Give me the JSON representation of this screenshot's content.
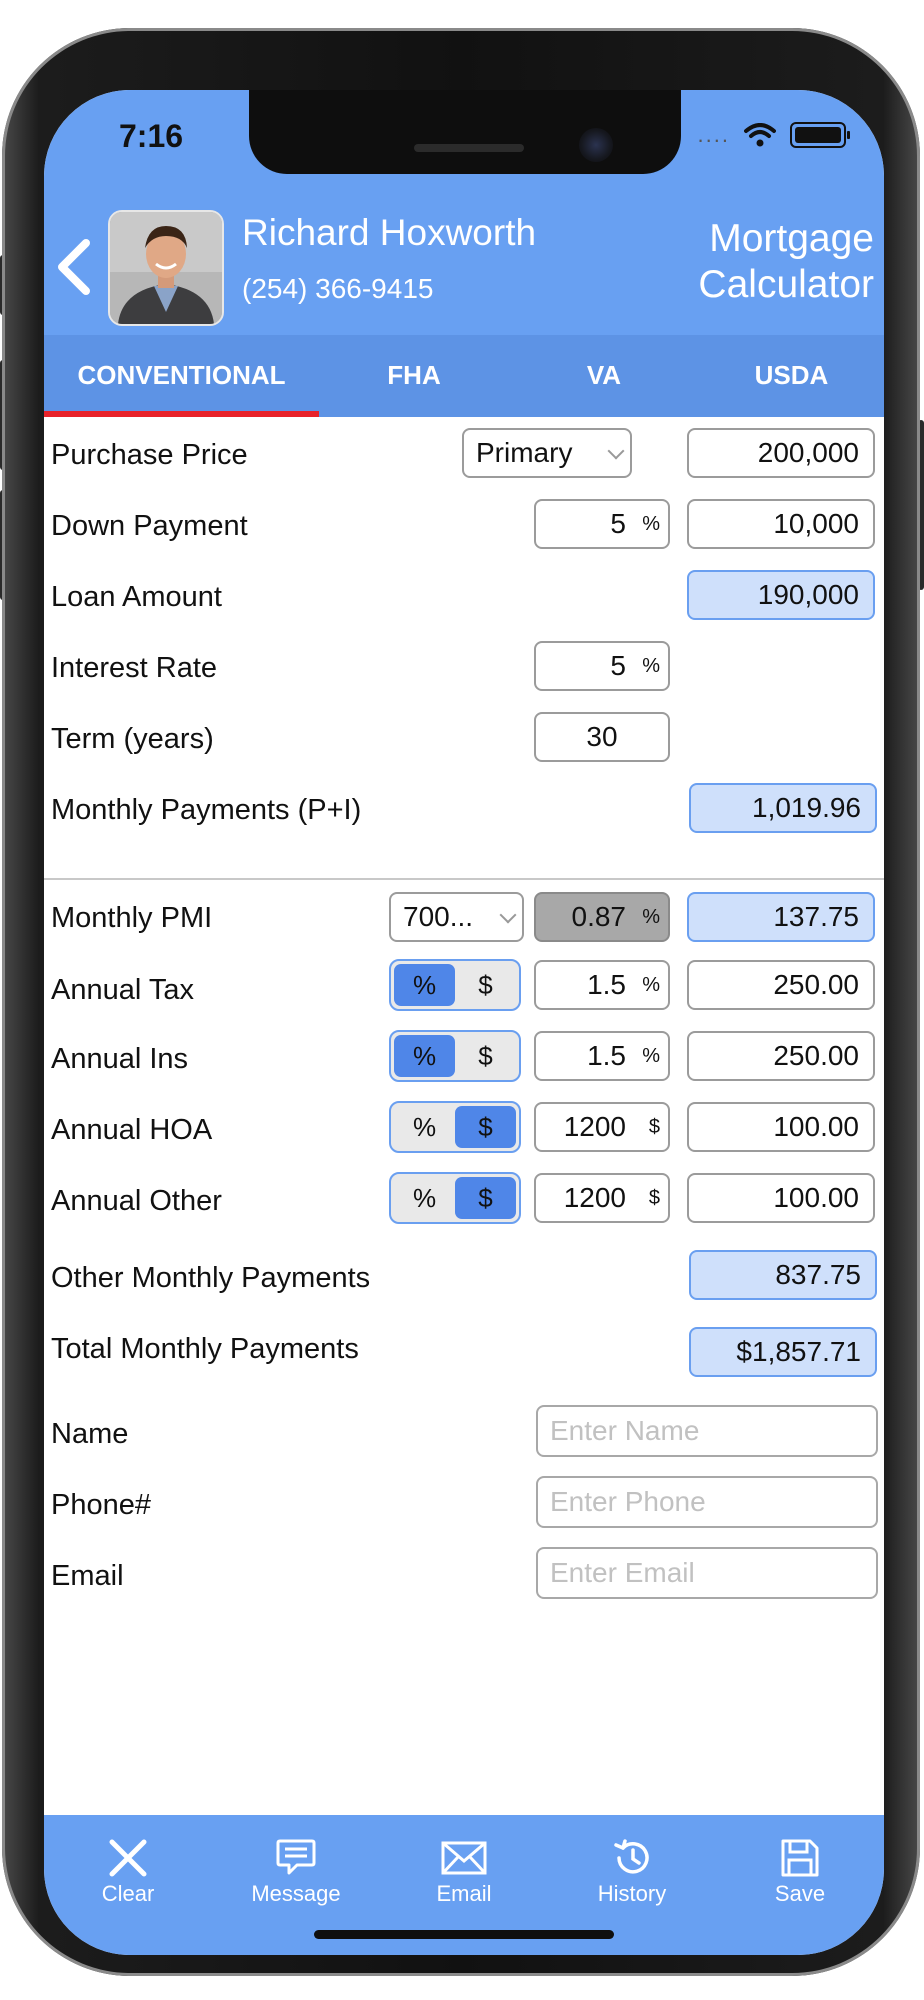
{
  "status_bar": {
    "time": "7:16",
    "signal": "....",
    "wifi_icon": "wifi-icon",
    "battery_icon": "battery-icon"
  },
  "header": {
    "back_icon": "chevron-left-icon",
    "agent_name": "Richard Hoxworth",
    "agent_phone": "(254) 366-9415",
    "title_line1": "Mortgage",
    "title_line2": "Calculator"
  },
  "tabs": [
    {
      "label": "CONVENTIONAL",
      "active": true
    },
    {
      "label": "FHA",
      "active": false
    },
    {
      "label": "VA",
      "active": false
    },
    {
      "label": "USDA",
      "active": false
    }
  ],
  "form": {
    "purchase_price": {
      "label": "Purchase Price",
      "occupancy": "Primary",
      "value": "200,000"
    },
    "down_payment": {
      "label": "Down Payment",
      "percent": "5",
      "unit": "%",
      "value": "10,000"
    },
    "loan_amount": {
      "label": "Loan Amount",
      "value": "190,000"
    },
    "interest_rate": {
      "label": "Interest Rate",
      "value": "5",
      "unit": "%"
    },
    "term": {
      "label": "Term (years)",
      "value": "30"
    },
    "monthly_pi": {
      "label": "Monthly Payments (P+I)",
      "value": "1,019.96"
    },
    "monthly_pmi": {
      "label": "Monthly PMI",
      "credit": "700...",
      "rate": "0.87",
      "unit": "%",
      "value": "137.75"
    },
    "annual_tax": {
      "label": "Annual Tax",
      "mode_pct": "%",
      "mode_usd": "$",
      "selected": "%",
      "input": "1.5",
      "unit": "%",
      "value": "250.00"
    },
    "annual_ins": {
      "label": "Annual Ins",
      "mode_pct": "%",
      "mode_usd": "$",
      "selected": "%",
      "input": "1.5",
      "unit": "%",
      "value": "250.00"
    },
    "annual_hoa": {
      "label": "Annual HOA",
      "mode_pct": "%",
      "mode_usd": "$",
      "selected": "$",
      "input": "1200",
      "unit": "$",
      "value": "100.00"
    },
    "annual_other": {
      "label": "Annual Other",
      "mode_pct": "%",
      "mode_usd": "$",
      "selected": "$",
      "input": "1200",
      "unit": "$",
      "value": "100.00"
    },
    "other_monthly": {
      "label": "Other Monthly Payments",
      "value": "837.75"
    },
    "total_monthly": {
      "label": "Total Monthly Payments",
      "value": "$1,857.71"
    }
  },
  "contact": {
    "name": {
      "label": "Name",
      "placeholder": "Enter Name",
      "value": ""
    },
    "phone": {
      "label": "Phone#",
      "placeholder": "Enter Phone",
      "value": ""
    },
    "email": {
      "label": "Email",
      "placeholder": "Enter Email",
      "value": ""
    }
  },
  "footer": [
    {
      "label": "Clear",
      "icon": "close-icon"
    },
    {
      "label": "Message",
      "icon": "message-icon"
    },
    {
      "label": "Email",
      "icon": "envelope-icon"
    },
    {
      "label": "History",
      "icon": "history-icon"
    },
    {
      "label": "Save",
      "icon": "save-icon"
    }
  ],
  "colors": {
    "header_blue": "#68a0f2",
    "tab_blue": "#5d93e5",
    "active_underline": "#e8222a",
    "computed_field": "#cfe0fb",
    "toggle_on": "#4f86e8"
  }
}
